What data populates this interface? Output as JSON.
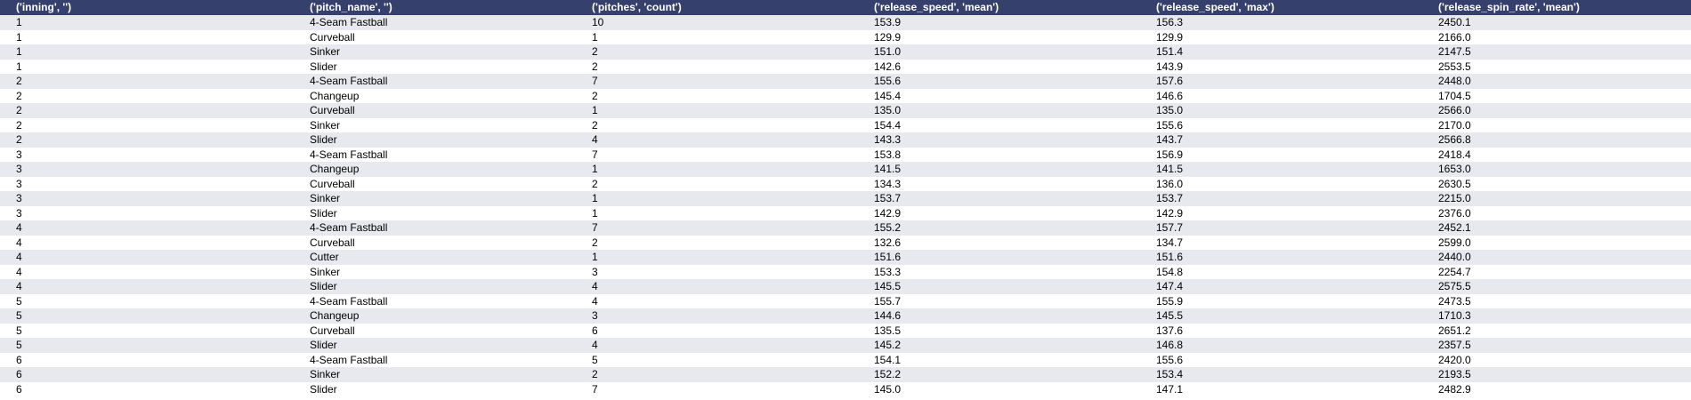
{
  "table": {
    "headers": [
      "('inning', '')",
      "('pitch_name', '')",
      "('pitches', 'count')",
      "('release_speed', 'mean')",
      "('release_speed', 'max')",
      "('release_spin_rate', 'mean')"
    ],
    "rows": [
      [
        "1",
        "4-Seam Fastball",
        "10",
        "153.9",
        "156.3",
        "2450.1"
      ],
      [
        "1",
        "Curveball",
        "1",
        "129.9",
        "129.9",
        "2166.0"
      ],
      [
        "1",
        "Sinker",
        "2",
        "151.0",
        "151.4",
        "2147.5"
      ],
      [
        "1",
        "Slider",
        "2",
        "142.6",
        "143.9",
        "2553.5"
      ],
      [
        "2",
        "4-Seam Fastball",
        "7",
        "155.6",
        "157.6",
        "2448.0"
      ],
      [
        "2",
        "Changeup",
        "2",
        "145.4",
        "146.6",
        "1704.5"
      ],
      [
        "2",
        "Curveball",
        "1",
        "135.0",
        "135.0",
        "2566.0"
      ],
      [
        "2",
        "Sinker",
        "2",
        "154.4",
        "155.6",
        "2170.0"
      ],
      [
        "2",
        "Slider",
        "4",
        "143.3",
        "143.7",
        "2566.8"
      ],
      [
        "3",
        "4-Seam Fastball",
        "7",
        "153.8",
        "156.9",
        "2418.4"
      ],
      [
        "3",
        "Changeup",
        "1",
        "141.5",
        "141.5",
        "1653.0"
      ],
      [
        "3",
        "Curveball",
        "2",
        "134.3",
        "136.0",
        "2630.5"
      ],
      [
        "3",
        "Sinker",
        "1",
        "153.7",
        "153.7",
        "2215.0"
      ],
      [
        "3",
        "Slider",
        "1",
        "142.9",
        "142.9",
        "2376.0"
      ],
      [
        "4",
        "4-Seam Fastball",
        "7",
        "155.2",
        "157.7",
        "2452.1"
      ],
      [
        "4",
        "Curveball",
        "2",
        "132.6",
        "134.7",
        "2599.0"
      ],
      [
        "4",
        "Cutter",
        "1",
        "151.6",
        "151.6",
        "2440.0"
      ],
      [
        "4",
        "Sinker",
        "3",
        "153.3",
        "154.8",
        "2254.7"
      ],
      [
        "4",
        "Slider",
        "4",
        "145.5",
        "147.4",
        "2575.5"
      ],
      [
        "5",
        "4-Seam Fastball",
        "4",
        "155.7",
        "155.9",
        "2473.5"
      ],
      [
        "5",
        "Changeup",
        "3",
        "144.6",
        "145.5",
        "1710.3"
      ],
      [
        "5",
        "Curveball",
        "6",
        "135.5",
        "137.6",
        "2651.2"
      ],
      [
        "5",
        "Slider",
        "4",
        "145.2",
        "146.8",
        "2357.5"
      ],
      [
        "6",
        "4-Seam Fastball",
        "5",
        "154.1",
        "155.6",
        "2420.0"
      ],
      [
        "6",
        "Sinker",
        "2",
        "152.2",
        "153.4",
        "2193.5"
      ],
      [
        "6",
        "Slider",
        "7",
        "145.0",
        "147.1",
        "2482.9"
      ]
    ]
  },
  "colors": {
    "header_bg": "#36406d",
    "header_text": "#ffffff",
    "row_stripe": "#e8e9ee",
    "row_plain": "#ffffff"
  }
}
